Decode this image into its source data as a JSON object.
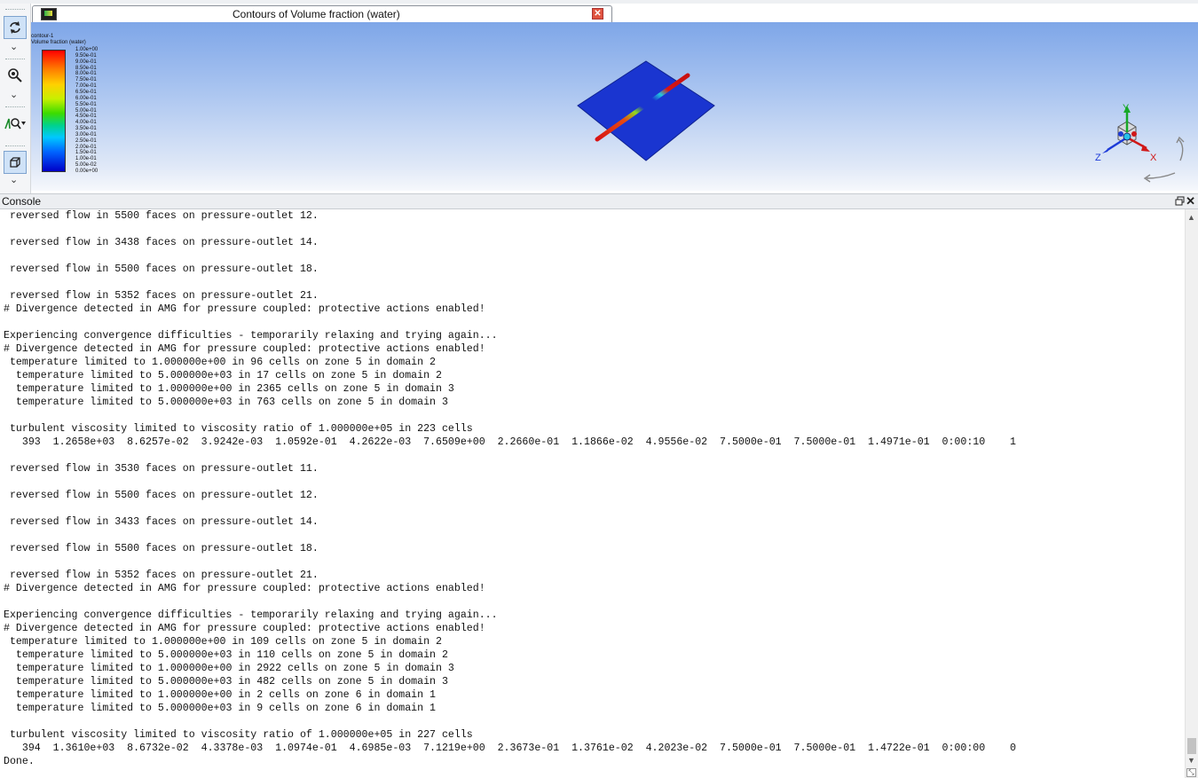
{
  "graphics": {
    "tab_title": "Contours of Volume fraction (water)",
    "tab_close_icon": "close-icon",
    "toolbar": {
      "tools": [
        "rotate-icon",
        "zoom-icon",
        "probe-icon",
        "view-cube-icon"
      ]
    },
    "legend": {
      "title_line1": "contour-1",
      "title_line2": "Volume fraction (water)",
      "ticks": [
        "1.00e+00",
        "9.50e-01",
        "9.00e-01",
        "8.50e-01",
        "8.00e-01",
        "7.50e-01",
        "7.00e-01",
        "6.50e-01",
        "6.00e-01",
        "5.50e-01",
        "5.00e-01",
        "4.50e-01",
        "4.00e-01",
        "3.50e-01",
        "3.00e-01",
        "2.50e-01",
        "2.00e-01",
        "1.50e-01",
        "1.00e-01",
        "5.00e-02",
        "0.00e+00"
      ],
      "colors": [
        "#ff0000",
        "#ffd000",
        "#3cdc00",
        "#00c8ff",
        "#0000c8"
      ]
    },
    "triad": {
      "x_label": "X",
      "y_label": "Y",
      "z_label": "Z"
    },
    "background_top": "#7ea6e8",
    "surface_color": "#1a35d0"
  },
  "console": {
    "title": "Console",
    "restore_icon": "restore-window-icon",
    "close_icon": "close-icon",
    "lines": [
      " reversed flow in 5500 faces on pressure-outlet 12.",
      "",
      " reversed flow in 3438 faces on pressure-outlet 14.",
      "",
      " reversed flow in 5500 faces on pressure-outlet 18.",
      "",
      " reversed flow in 5352 faces on pressure-outlet 21.",
      "# Divergence detected in AMG for pressure coupled: protective actions enabled!",
      "",
      "Experiencing convergence difficulties - temporarily relaxing and trying again...",
      "# Divergence detected in AMG for pressure coupled: protective actions enabled!",
      " temperature limited to 1.000000e+00 in 96 cells on zone 5 in domain 2",
      "  temperature limited to 5.000000e+03 in 17 cells on zone 5 in domain 2",
      "  temperature limited to 1.000000e+00 in 2365 cells on zone 5 in domain 3",
      "  temperature limited to 5.000000e+03 in 763 cells on zone 5 in domain 3",
      "",
      " turbulent viscosity limited to viscosity ratio of 1.000000e+05 in 223 cells",
      "   393  1.2658e+03  8.6257e-02  3.9242e-03  1.0592e-01  4.2622e-03  7.6509e+00  2.2660e-01  1.1866e-02  4.9556e-02  7.5000e-01  7.5000e-01  1.4971e-01  0:00:10    1",
      "",
      " reversed flow in 3530 faces on pressure-outlet 11.",
      "",
      " reversed flow in 5500 faces on pressure-outlet 12.",
      "",
      " reversed flow in 3433 faces on pressure-outlet 14.",
      "",
      " reversed flow in 5500 faces on pressure-outlet 18.",
      "",
      " reversed flow in 5352 faces on pressure-outlet 21.",
      "# Divergence detected in AMG for pressure coupled: protective actions enabled!",
      "",
      "Experiencing convergence difficulties - temporarily relaxing and trying again...",
      "# Divergence detected in AMG for pressure coupled: protective actions enabled!",
      " temperature limited to 1.000000e+00 in 109 cells on zone 5 in domain 2",
      "  temperature limited to 5.000000e+03 in 110 cells on zone 5 in domain 2",
      "  temperature limited to 1.000000e+00 in 2922 cells on zone 5 in domain 3",
      "  temperature limited to 5.000000e+03 in 482 cells on zone 5 in domain 3",
      "  temperature limited to 1.000000e+00 in 2 cells on zone 6 in domain 1",
      "  temperature limited to 5.000000e+03 in 9 cells on zone 6 in domain 1",
      "",
      " turbulent viscosity limited to viscosity ratio of 1.000000e+05 in 227 cells",
      "   394  1.3610e+03  8.6732e-02  4.3378e-03  1.0974e-01  4.6985e-03  7.1219e+00  2.3673e-01  1.3761e-02  4.2023e-02  7.5000e-01  7.5000e-01  1.4722e-01  0:00:00    0",
      "Done."
    ]
  }
}
